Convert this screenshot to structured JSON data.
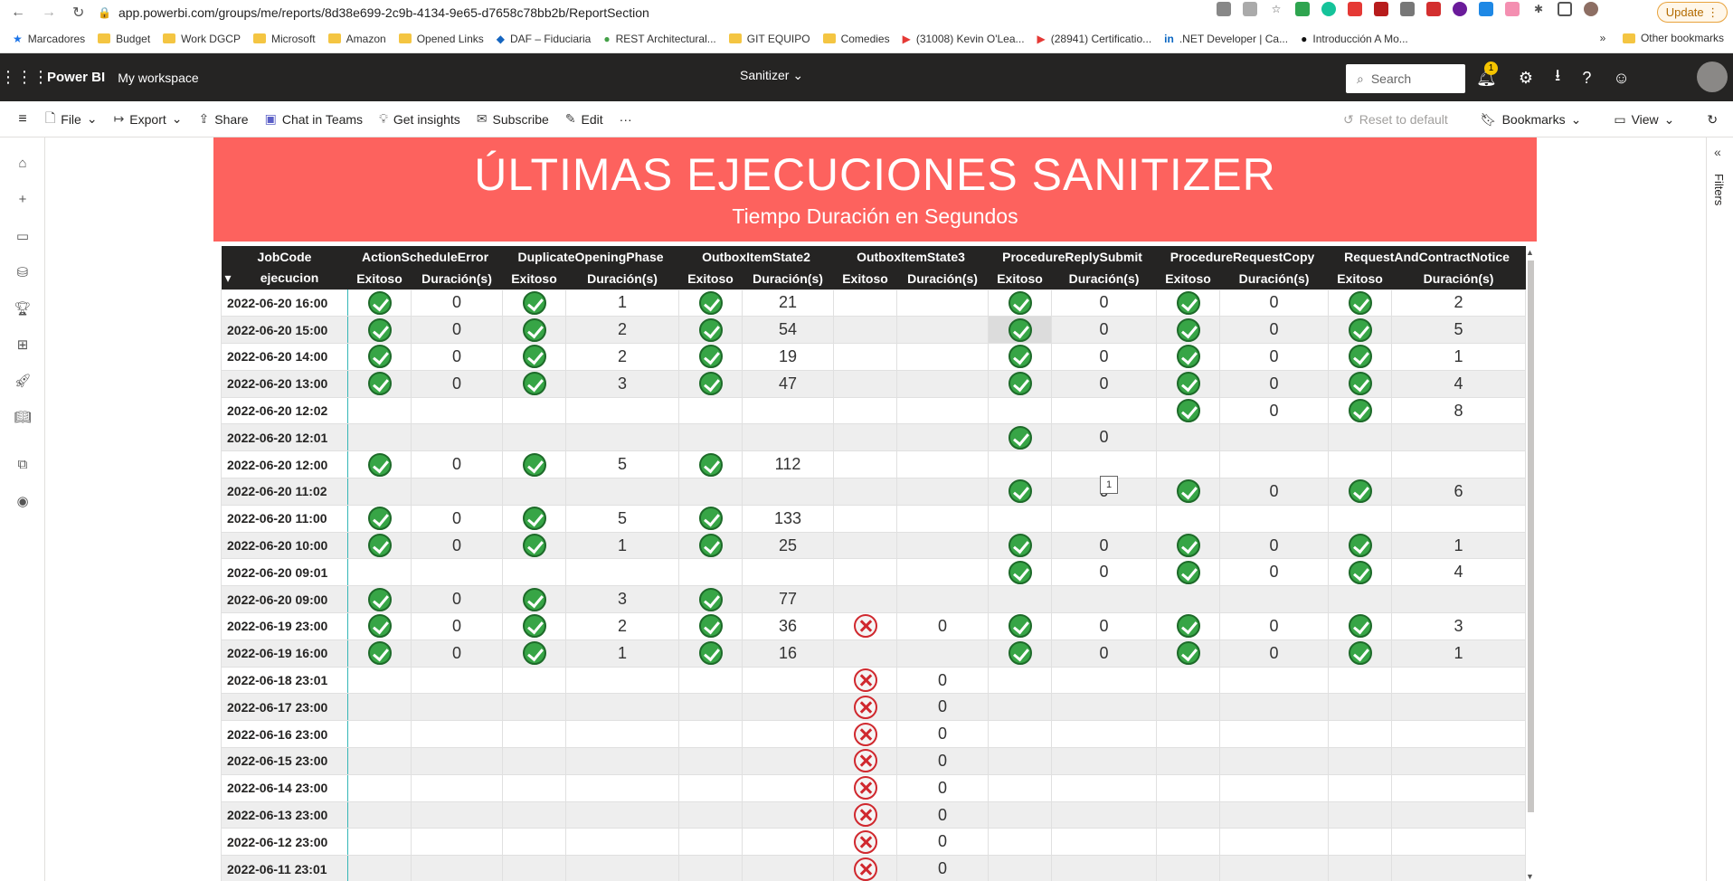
{
  "browser": {
    "url": "app.powerbi.com/groups/me/reports/8d38e699-2c9b-4134-9e65-d7658c78bb2b/ReportSection",
    "update_label": "Update",
    "bookmarks": [
      "Marcadores",
      "Budget",
      "Work DGCP",
      "Microsoft",
      "Amazon",
      "Opened Links",
      "DAF – Fiduciaria",
      "REST Architectural...",
      "GIT EQUIPO",
      "Comedies",
      "(31008) Kevin O'Lea...",
      "(28941) Certificatio...",
      ".NET Developer | Ca...",
      "Introducción A Mo..."
    ],
    "other_bookmarks": "Other bookmarks"
  },
  "header": {
    "app_name": "Power BI",
    "workspace": "My workspace",
    "report_title": "Sanitizer",
    "search_placeholder": "Search",
    "notifications_count": "1"
  },
  "toolbar": {
    "file": "File",
    "export": "Export",
    "share": "Share",
    "chat_in_teams": "Chat in Teams",
    "get_insights": "Get insights",
    "subscribe": "Subscribe",
    "edit": "Edit",
    "more": "···",
    "reset": "Reset to default",
    "bookmarks": "Bookmarks",
    "view": "View"
  },
  "filters_label": "Filters",
  "banner": {
    "title": "ÚLTIMAS  EJECUCIONES SANITIZER",
    "subtitle": "Tiempo Duración en Segundos"
  },
  "matrix": {
    "row_header_top": "JobCode",
    "row_header_bottom": "ejecucion",
    "groups": [
      "ActionScheduleError",
      "DuplicateOpeningPhase",
      "OutboxItemState2",
      "OutboxItemState3",
      "ProcedureReplySubmit",
      "ProcedureRequestCopy",
      "RequestAndContractNotice"
    ],
    "sub_ok": "Exitoso",
    "sub_dur": "Duración(s)",
    "rows": [
      {
        "date": "2022-06-20 16:00",
        "cells": [
          [
            "ok",
            "0"
          ],
          [
            "ok",
            "1"
          ],
          [
            "ok",
            "21"
          ],
          null,
          [
            "ok",
            "0"
          ],
          [
            "ok",
            "0"
          ],
          [
            "ok",
            "2"
          ]
        ]
      },
      {
        "date": "2022-06-20 15:00",
        "cells": [
          [
            "ok",
            "0"
          ],
          [
            "ok",
            "2"
          ],
          [
            "ok",
            "54"
          ],
          null,
          [
            "ok",
            "0"
          ],
          [
            "ok",
            "0"
          ],
          [
            "ok",
            "5"
          ]
        ]
      },
      {
        "date": "2022-06-20 14:00",
        "cells": [
          [
            "ok",
            "0"
          ],
          [
            "ok",
            "2"
          ],
          [
            "ok",
            "19"
          ],
          null,
          [
            "ok",
            "0"
          ],
          [
            "ok",
            "0"
          ],
          [
            "ok",
            "1"
          ]
        ]
      },
      {
        "date": "2022-06-20 13:00",
        "cells": [
          [
            "ok",
            "0"
          ],
          [
            "ok",
            "3"
          ],
          [
            "ok",
            "47"
          ],
          null,
          [
            "ok",
            "0"
          ],
          [
            "ok",
            "0"
          ],
          [
            "ok",
            "4"
          ]
        ]
      },
      {
        "date": "2022-06-20 12:02",
        "cells": [
          null,
          null,
          null,
          null,
          null,
          [
            "ok",
            "0"
          ],
          [
            "ok",
            "8"
          ]
        ]
      },
      {
        "date": "2022-06-20 12:01",
        "cells": [
          null,
          null,
          null,
          null,
          [
            "ok",
            "0"
          ],
          null,
          null
        ]
      },
      {
        "date": "2022-06-20 12:00",
        "cells": [
          [
            "ok",
            "0"
          ],
          [
            "ok",
            "5"
          ],
          [
            "ok",
            "112"
          ],
          null,
          null,
          null,
          null
        ]
      },
      {
        "date": "2022-06-20 11:02",
        "cells": [
          null,
          null,
          null,
          null,
          [
            "ok",
            "0"
          ],
          [
            "ok",
            "0"
          ],
          [
            "ok",
            "6"
          ]
        ]
      },
      {
        "date": "2022-06-20 11:00",
        "cells": [
          [
            "ok",
            "0"
          ],
          [
            "ok",
            "5"
          ],
          [
            "ok",
            "133"
          ],
          null,
          null,
          null,
          null
        ]
      },
      {
        "date": "2022-06-20 10:00",
        "cells": [
          [
            "ok",
            "0"
          ],
          [
            "ok",
            "1"
          ],
          [
            "ok",
            "25"
          ],
          null,
          [
            "ok",
            "0"
          ],
          [
            "ok",
            "0"
          ],
          [
            "ok",
            "1"
          ]
        ]
      },
      {
        "date": "2022-06-20 09:01",
        "cells": [
          null,
          null,
          null,
          null,
          [
            "ok",
            "0"
          ],
          [
            "ok",
            "0"
          ],
          [
            "ok",
            "4"
          ]
        ]
      },
      {
        "date": "2022-06-20 09:00",
        "cells": [
          [
            "ok",
            "0"
          ],
          [
            "ok",
            "3"
          ],
          [
            "ok",
            "77"
          ],
          null,
          null,
          null,
          null
        ]
      },
      {
        "date": "2022-06-19 23:00",
        "cells": [
          [
            "ok",
            "0"
          ],
          [
            "ok",
            "2"
          ],
          [
            "ok",
            "36"
          ],
          [
            "fail",
            "0"
          ],
          [
            "ok",
            "0"
          ],
          [
            "ok",
            "0"
          ],
          [
            "ok",
            "3"
          ]
        ]
      },
      {
        "date": "2022-06-19 16:00",
        "cells": [
          [
            "ok",
            "0"
          ],
          [
            "ok",
            "1"
          ],
          [
            "ok",
            "16"
          ],
          null,
          [
            "ok",
            "0"
          ],
          [
            "ok",
            "0"
          ],
          [
            "ok",
            "1"
          ]
        ]
      },
      {
        "date": "2022-06-18 23:01",
        "cells": [
          null,
          null,
          null,
          [
            "fail",
            "0"
          ],
          null,
          null,
          null
        ]
      },
      {
        "date": "2022-06-17 23:00",
        "cells": [
          null,
          null,
          null,
          [
            "fail",
            "0"
          ],
          null,
          null,
          null
        ]
      },
      {
        "date": "2022-06-16 23:00",
        "cells": [
          null,
          null,
          null,
          [
            "fail",
            "0"
          ],
          null,
          null,
          null
        ]
      },
      {
        "date": "2022-06-15 23:00",
        "cells": [
          null,
          null,
          null,
          [
            "fail",
            "0"
          ],
          null,
          null,
          null
        ]
      },
      {
        "date": "2022-06-14 23:00",
        "cells": [
          null,
          null,
          null,
          [
            "fail",
            "0"
          ],
          null,
          null,
          null
        ]
      },
      {
        "date": "2022-06-13 23:00",
        "cells": [
          null,
          null,
          null,
          [
            "fail",
            "0"
          ],
          null,
          null,
          null
        ]
      },
      {
        "date": "2022-06-12 23:00",
        "cells": [
          null,
          null,
          null,
          [
            "fail",
            "0"
          ],
          null,
          null,
          null
        ]
      },
      {
        "date": "2022-06-11 23:01",
        "cells": [
          null,
          null,
          null,
          [
            "fail",
            "0"
          ],
          null,
          null,
          null
        ]
      }
    ],
    "tooltip_value": "1"
  },
  "colors": {
    "banner_bg": "#fd625e",
    "header_bg": "#252423",
    "success": "#37a546",
    "failure": "#d0282e"
  }
}
